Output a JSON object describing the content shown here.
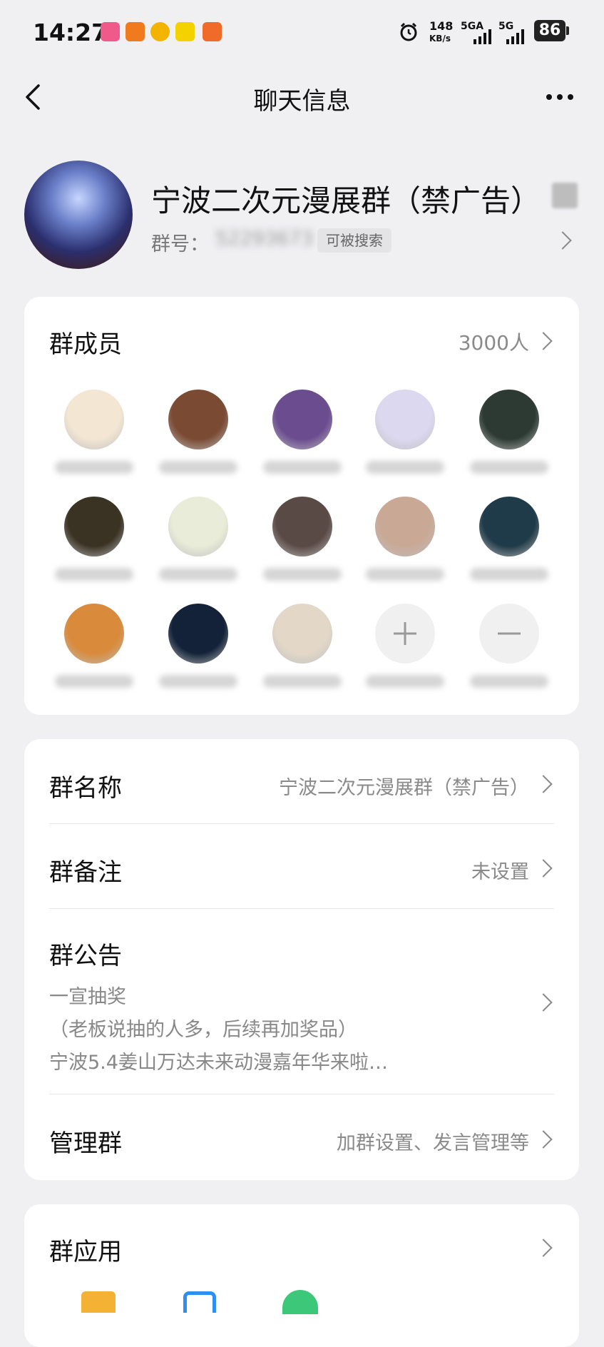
{
  "status_bar": {
    "time": "14:27",
    "speed_value": "148",
    "speed_unit": "KB/s",
    "net1": "5GA",
    "net2": "5G",
    "battery": "86"
  },
  "header": {
    "title": "聊天信息"
  },
  "group": {
    "name": "宁波二次元漫展群（禁广告）",
    "number_label": "群号：",
    "number": "52293673",
    "searchable": "可被搜索"
  },
  "members": {
    "title": "群成员",
    "count": "3000人",
    "avatars": [
      {
        "color": "#f3e6d3"
      },
      {
        "color": "#7a4a33"
      },
      {
        "color": "#6b4c8f"
      },
      {
        "color": "#dcd8f0"
      },
      {
        "color": "#2d3a33"
      },
      {
        "color": "#3a3324"
      },
      {
        "color": "#e8ecd8"
      },
      {
        "color": "#5a4a46"
      },
      {
        "color": "#c9a996"
      },
      {
        "color": "#1f3a48"
      },
      {
        "color": "#d98a3a"
      },
      {
        "color": "#132238"
      },
      {
        "color": "#e3d8c8"
      }
    ]
  },
  "settings": {
    "group_name_label": "群名称",
    "group_name_value": "宁波二次元漫展群（禁广告）",
    "remark_label": "群备注",
    "remark_value": "未设置",
    "notice_label": "群公告",
    "notice_line1": "一宣抽奖",
    "notice_line2": "（老板说抽的人多，后续再加奖品）",
    "notice_line3": "宁波5.4姜山万达未来动漫嘉年华来啦…",
    "manage_label": "管理群",
    "manage_value": "加群设置、发言管理等"
  },
  "apps": {
    "label": "群应用"
  },
  "colors": {
    "background": "#f0f0f3",
    "card": "#ffffff",
    "secondary_text": "#8a8a8a"
  },
  "icons": [
    "back-arrow-icon",
    "more-dots-icon",
    "chevron-right-icon",
    "add-member-icon",
    "remove-member-icon",
    "alarm-icon",
    "signal-icon",
    "battery-icon"
  ]
}
